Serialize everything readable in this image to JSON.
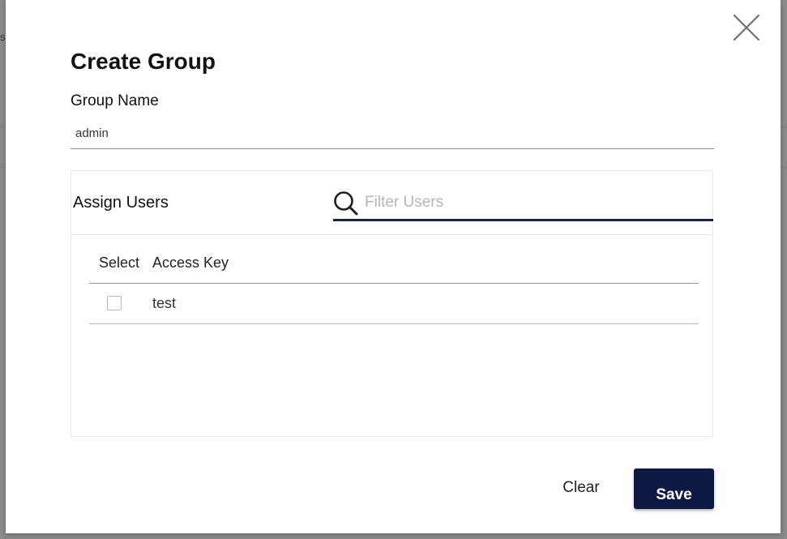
{
  "background": {
    "fragment_text": "s"
  },
  "dialog": {
    "title": "Create Group",
    "close_icon": "close-icon",
    "group_name": {
      "label": "Group Name",
      "value": "admin"
    },
    "assign_users": {
      "title": "Assign Users",
      "filter": {
        "icon": "search-icon",
        "placeholder": "Filter Users",
        "value": ""
      },
      "table": {
        "columns": [
          "Select",
          "Access Key"
        ],
        "rows": [
          {
            "selected": false,
            "access_key": "test"
          }
        ]
      }
    },
    "buttons": {
      "clear_label": "Clear",
      "save_label": "Save"
    }
  },
  "colors": {
    "primary": "#0e1a44",
    "filter_underline": "#1a2347",
    "backdrop": "#8a8a8a"
  }
}
